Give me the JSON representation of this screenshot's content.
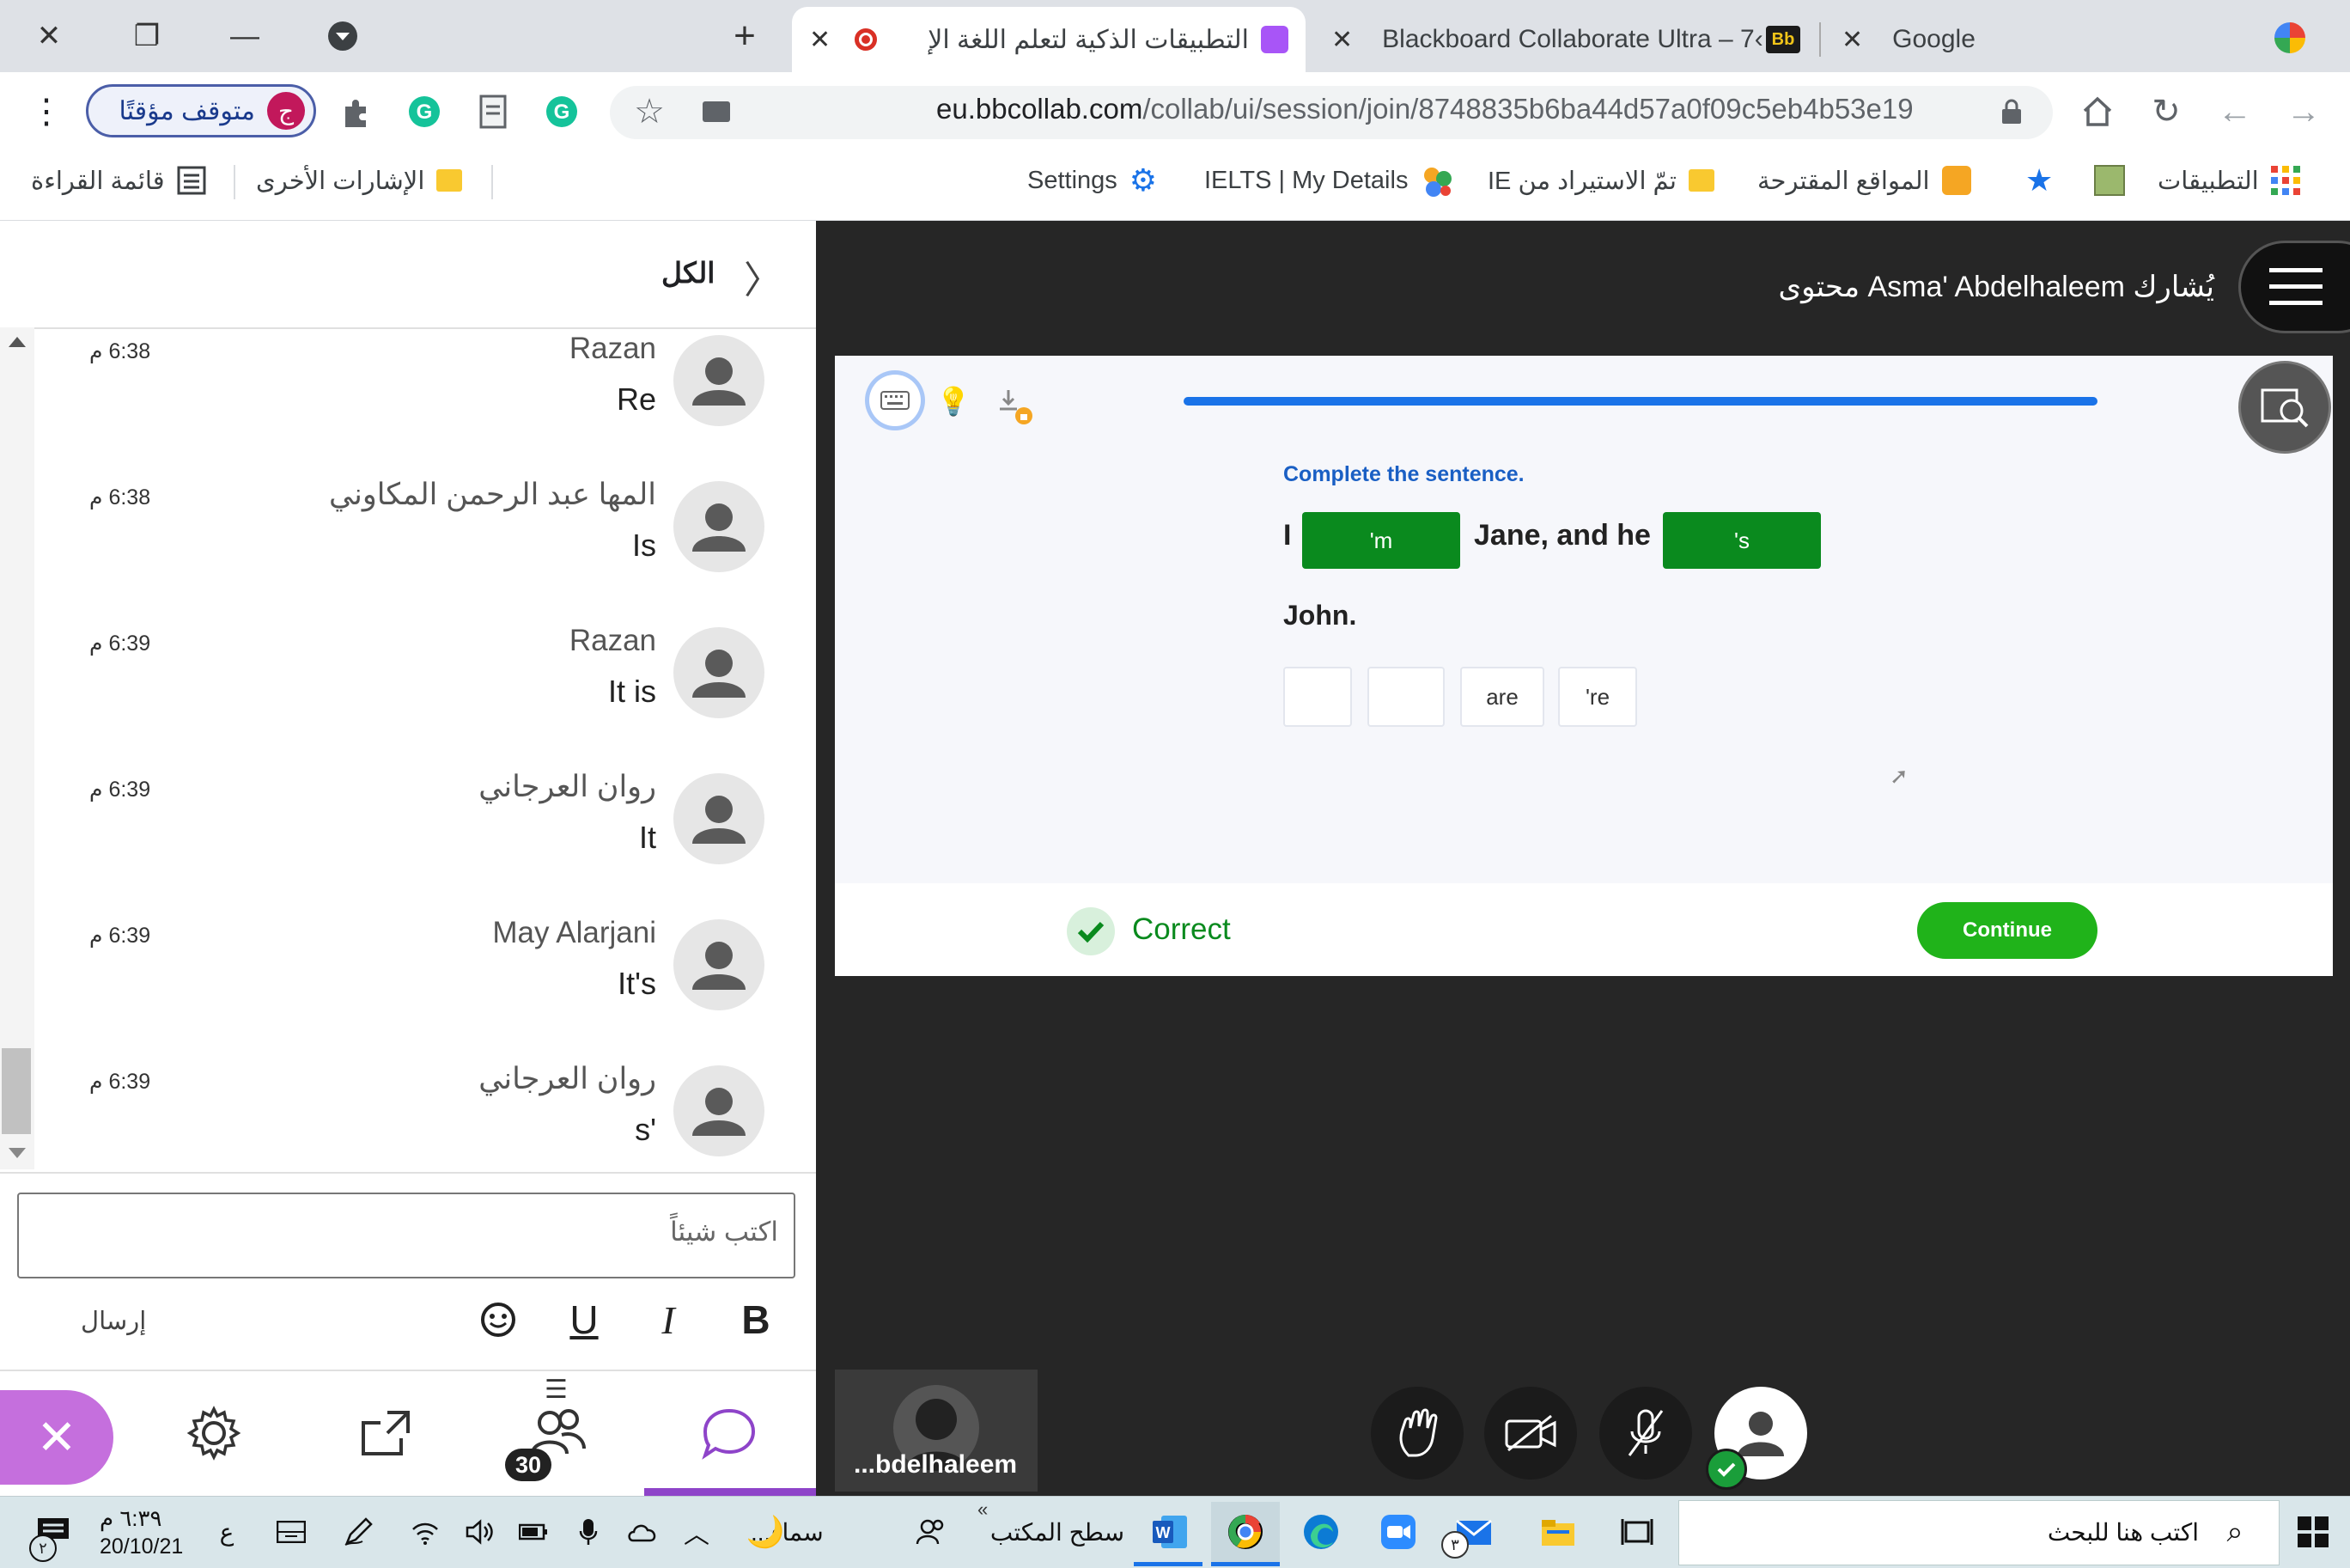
{
  "browser": {
    "tabs": [
      {
        "title": "التطبيقات الذكية لتعلم اللغة الإ",
        "active": true
      },
      {
        "title": "Blackboard Collaborate Ultra – 7‹",
        "active": false
      },
      {
        "title": "Google",
        "active": false
      }
    ],
    "new_tab": "+",
    "url_domain": "eu.bbcollab.com",
    "url_path": "/collab/ui/session/join/8748835b6ba44d57a0f09c5eb4b53e19",
    "profile_label": "متوقف مؤقتًا",
    "profile_initial": "ج",
    "bookmarks": [
      {
        "label": "التطبيقات",
        "icon": "apps-grid-icon"
      },
      {
        "label": "",
        "icon": "bookmark-image-icon"
      },
      {
        "label": "",
        "icon": "star-icon"
      },
      {
        "label": "المواقع المقترحة",
        "icon": "suggested-sites-icon"
      },
      {
        "label": "تمّ الاستيراد من IE",
        "icon": "folder-icon"
      },
      {
        "label": "IELTS | My Details",
        "icon": "ielts-icon"
      },
      {
        "label": "Settings",
        "icon": "gear-icon"
      }
    ],
    "other_bookmarks": "الإشارات الأخرى",
    "reading_list": "قائمة القراءة"
  },
  "chat": {
    "header_title": "الكل",
    "messages": [
      {
        "name": "Razan",
        "text": "Re",
        "time": "6:38 م"
      },
      {
        "name": "المها عبد الرحمن المكاوني",
        "text": "Is",
        "time": "6:38 م"
      },
      {
        "name": "Razan",
        "text": "It is",
        "time": "6:39 م"
      },
      {
        "name": "روان العرجاني",
        "text": "It",
        "time": "6:39 م"
      },
      {
        "name": "May Alarjani",
        "text": "It's",
        "time": "6:39 م"
      },
      {
        "name": "روان العرجاني",
        "text": "s'",
        "time": "6:39 م"
      }
    ],
    "input_placeholder": "اكتب شيئاً",
    "send_label": "إرسال",
    "format": {
      "bold": "B",
      "italic": "I",
      "underline": "U"
    },
    "participants_count": "30"
  },
  "stage": {
    "sharing_text": "يُشارك Asma' Abdelhaleem محتوى",
    "exercise": {
      "instruction": "Complete the sentence.",
      "word_i": "I",
      "filled_1": "'m",
      "middle": "Jane, and he",
      "filled_2": "'s",
      "word_john": "John.",
      "options": [
        "",
        "",
        "are",
        "'re"
      ],
      "progress": 1.0
    },
    "result": "Correct",
    "continue_label": "Continue",
    "presenter_tile_name": "...bdelhaleem",
    "colors": {
      "accent_blue": "#1a73e8",
      "correct_green": "#0a8a1e",
      "continue_green": "#20b31a",
      "chat_purple": "#8e44c9"
    }
  },
  "taskbar": {
    "search_placeholder": "اكتب هنا للبحث",
    "desktop_label": "سطح المكتب",
    "weather_label": "سماء...",
    "time": "٦:٣٩ م",
    "date": "20/10/21",
    "lang": "ع",
    "mail_badge": "٣",
    "notif_badge": "٢"
  }
}
